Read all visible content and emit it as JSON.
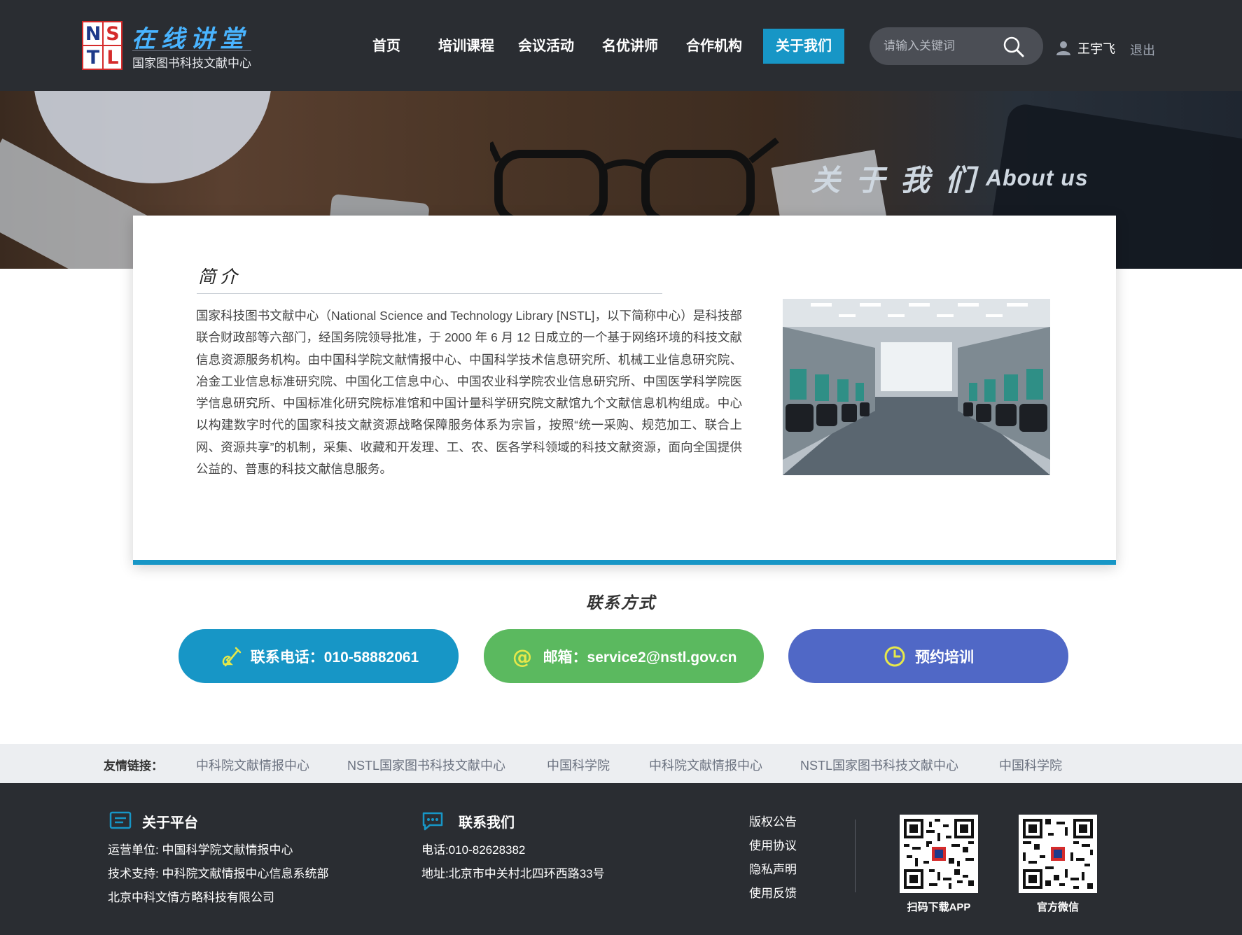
{
  "brand": {
    "logo": {
      "top_left": "N",
      "top_right": "S",
      "bottom_left": "T",
      "bottom_right": "L"
    },
    "title": "在线讲堂",
    "subtitle": "国家图书科技文献中心"
  },
  "nav": {
    "items": [
      {
        "label": "首页",
        "active": false
      },
      {
        "label": "培训课程",
        "active": false
      },
      {
        "label": "会议活动",
        "active": false
      },
      {
        "label": "名优讲师",
        "active": false
      },
      {
        "label": "合作机构",
        "active": false
      },
      {
        "label": "关于我们",
        "active": true
      }
    ]
  },
  "search": {
    "placeholder": "请输入关键词",
    "value": "",
    "icon": "search-icon"
  },
  "user": {
    "name": "王宇飞",
    "logout": "退出",
    "icon": "user-icon"
  },
  "banner": {
    "title": "关于我们",
    "title_en": "About us"
  },
  "intro": {
    "heading": "简介",
    "body": "国家科技图书文献中心（National Science and Technology Library [NSTL]，以下简称中心）是科技部联合财政部等六部门，经国务院领导批准，于 2000 年 6 月 12 日成立的一个基于网络环境的科技文献信息资源服务机构。由中国科学院文献情报中心、中国科学技术信息研究所、机械工业信息研究院、冶金工业信息标准研究院、中国化工信息中心、中国农业科学院农业信息研究所、中国医学科学院医学信息研究所、中国标准化研究院标准馆和中国计量科学研究院文献馆九个文献信息机构组成。中心以构建数字时代的国家科技文献资源战略保障服务体系为宗旨，按照“统一采购、规范加工、联合上网、资源共享”的机制，采集、收藏和开发理、工、农、医各学科领域的科技文献资源，面向全国提供公益的、普惠的科技文献信息服务。"
  },
  "contact": {
    "title": "联系方式",
    "phone": {
      "label": "联系电话：010-58882061",
      "icon": "phone-icon",
      "color": "#1796c6"
    },
    "email": {
      "label": "邮箱：service2@nstl.gov.cn",
      "icon": "at-icon",
      "color": "#5bb95f"
    },
    "booking": {
      "label": "预约培训",
      "icon": "clock-icon",
      "color": "#5068c6"
    }
  },
  "friend_links": {
    "label": "友情链接：",
    "items": [
      "中科院文献情报中心",
      "NSTL国家图书科技文献中心",
      "中国科学院",
      "中科院文献情报中心",
      "NSTL国家图书科技文献中心",
      "中国科学院"
    ]
  },
  "footer": {
    "about": {
      "title": "关于平台",
      "icon": "message-icon",
      "lines": [
        "运营单位: 中国科学院文献情报中心",
        "技术支持: 中科院文献情报中心信息系统部",
        "北京中科文情方略科技有限公司"
      ]
    },
    "contact_us": {
      "title": "联系我们",
      "icon": "chat-icon",
      "lines": [
        "电话:010-82628382",
        "地址:北京市中关村北四环西路33号"
      ]
    },
    "links": [
      "版权公告",
      "使用协议",
      "隐私声明",
      "使用反馈"
    ],
    "qr": [
      {
        "caption": "扫码下载APP"
      },
      {
        "caption": "官方微信"
      }
    ]
  },
  "colors": {
    "header_bg": "#2a2d32",
    "accent": "#1796c6",
    "green": "#5bb95f",
    "indigo": "#5068c6"
  }
}
